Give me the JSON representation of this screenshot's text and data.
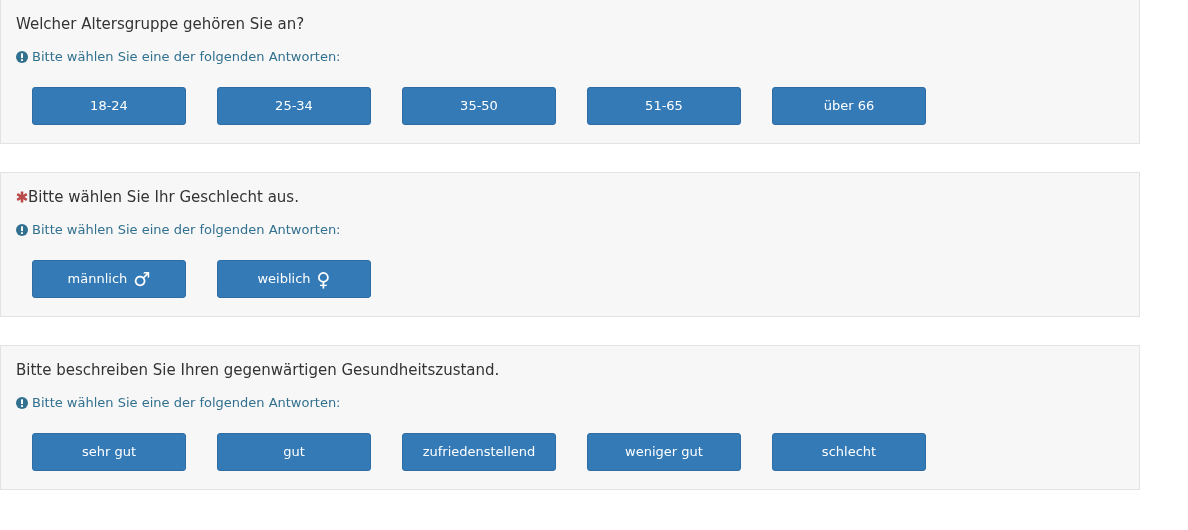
{
  "questions": [
    {
      "text": "Welcher Altersgruppe gehören Sie an?",
      "mandatory": false,
      "hint": "Bitte wählen Sie eine der folgenden Antworten:",
      "answers": [
        {
          "label": "18-24"
        },
        {
          "label": "25-34"
        },
        {
          "label": "35-50"
        },
        {
          "label": "51-65"
        },
        {
          "label": "über 66"
        }
      ]
    },
    {
      "text": "Bitte wählen Sie Ihr Geschlecht aus.",
      "mandatory": true,
      "hint": "Bitte wählen Sie eine der folgenden Antworten:",
      "answers": [
        {
          "label": "männlich",
          "symbol": "♂"
        },
        {
          "label": "weiblich",
          "symbol": "♀"
        }
      ]
    },
    {
      "text": "Bitte beschreiben Sie Ihren gegenwärtigen Gesundheitszustand.",
      "mandatory": false,
      "hint": "Bitte wählen Sie eine der folgenden Antworten:",
      "answers": [
        {
          "label": "sehr gut"
        },
        {
          "label": "gut"
        },
        {
          "label": "zufriedenstellend"
        },
        {
          "label": "weniger gut"
        },
        {
          "label": "schlecht"
        }
      ]
    }
  ]
}
